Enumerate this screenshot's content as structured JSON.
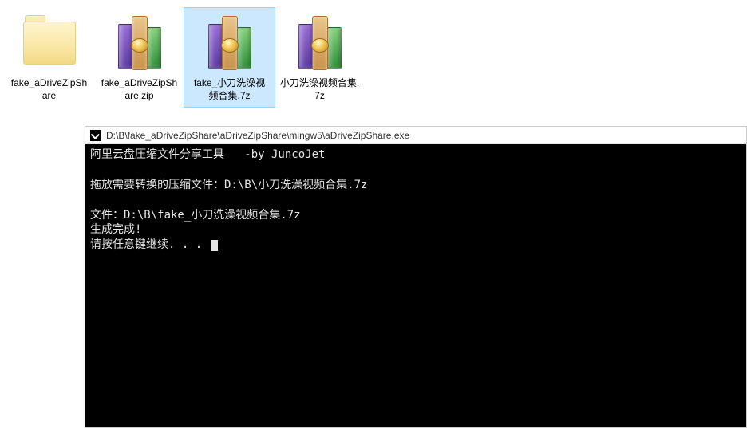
{
  "files": [
    {
      "label": "fake_aDriveZipShare",
      "type": "folder",
      "selected": false
    },
    {
      "label": "fake_aDriveZipShare.zip",
      "type": "archive",
      "selected": false
    },
    {
      "label": "fake_小刀洗澡视频合集.7z",
      "type": "archive",
      "selected": true
    },
    {
      "label": "小刀洗澡视频合集.7z",
      "type": "archive",
      "selected": false
    }
  ],
  "console": {
    "title": "D:\\B\\fake_aDriveZipShare\\aDriveZipShare\\mingw5\\aDriveZipShare.exe",
    "line1": "阿里云盘压缩文件分享工具   -by JuncoJet",
    "blank1": "",
    "line2": "拖放需要转换的压缩文件：D:\\B\\小刀洗澡视频合集.7z",
    "blank2": "",
    "line3": "文件：D:\\B\\fake_小刀洗澡视频合集.7z",
    "line4": "生成完成!",
    "line5": "请按任意键继续. . . "
  }
}
